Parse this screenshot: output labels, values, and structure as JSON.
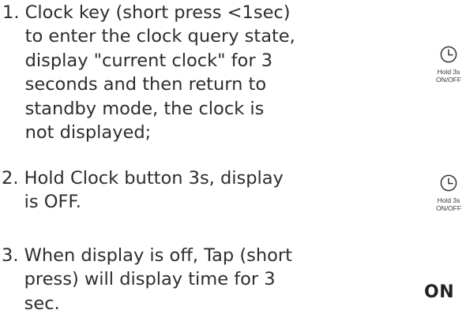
{
  "steps": [
    {
      "number": "1. ",
      "lines": [
        "Clock key (short press <1sec)",
        "to enter the clock query state,",
        "display \"current clock\" for 3",
        "seconds and then return to",
        "standby mode, the clock is",
        "not displayed;"
      ]
    },
    {
      "number": "2. ",
      "lines": [
        "Hold Clock button 3s, display",
        "is OFF."
      ]
    },
    {
      "number": "3. ",
      "lines": [
        "When display is off, Tap (short",
        "press) will display time for 3",
        "sec."
      ]
    }
  ],
  "keys": [
    {
      "icon": "clock-icon",
      "label_line1": "Hold 3s",
      "label_line2": "ON/OFF"
    },
    {
      "icon": "clock-icon",
      "label_line1": "Hold 3s",
      "label_line2": "ON/OFF"
    }
  ],
  "on_label": "ON"
}
